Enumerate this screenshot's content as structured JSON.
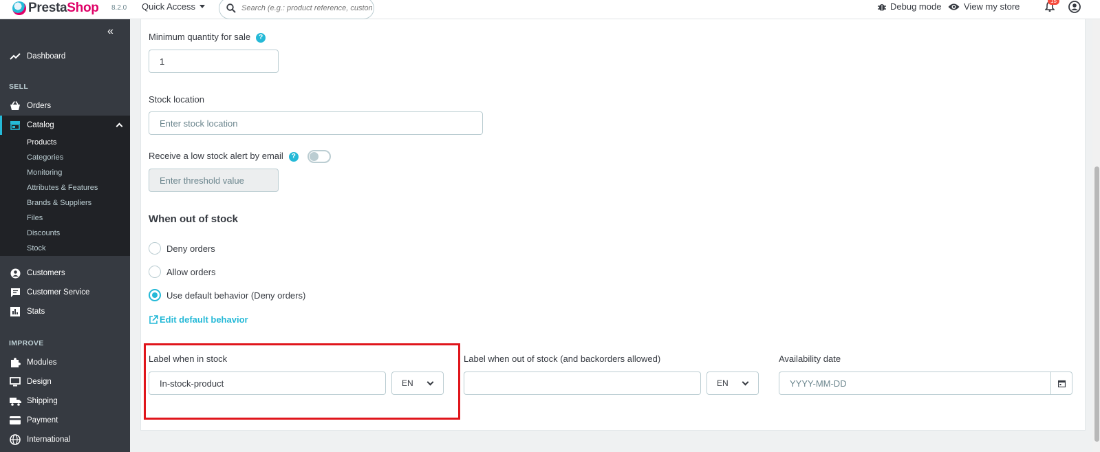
{
  "header": {
    "logo_text_a": "Presta",
    "logo_text_b": "Shop",
    "version": "8.2.0",
    "quick_access": "Quick Access",
    "search_placeholder": "Search (e.g.: product reference, custon",
    "debug_mode": "Debug mode",
    "view_store": "View my store",
    "notifications_count": "15"
  },
  "sidebar": {
    "dashboard": "Dashboard",
    "section_sell": "SELL",
    "orders": "Orders",
    "catalog": "Catalog",
    "catalog_sub": [
      "Products",
      "Categories",
      "Monitoring",
      "Attributes & Features",
      "Brands & Suppliers",
      "Files",
      "Discounts",
      "Stock"
    ],
    "customers": "Customers",
    "customer_service": "Customer Service",
    "stats": "Stats",
    "section_improve": "IMPROVE",
    "modules": "Modules",
    "design": "Design",
    "shipping": "Shipping",
    "payment": "Payment",
    "international": "International"
  },
  "form": {
    "min_qty_label": "Minimum quantity for sale",
    "min_qty_value": "1",
    "stock_location_label": "Stock location",
    "stock_location_placeholder": "Enter stock location",
    "low_stock_label": "Receive a low stock alert by email",
    "threshold_placeholder": "Enter threshold value",
    "out_of_stock_heading": "When out of stock",
    "radio_deny": "Deny orders",
    "radio_allow": "Allow orders",
    "radio_default": "Use default behavior (Deny orders)",
    "edit_default": "Edit default behavior",
    "label_in_stock": "Label when in stock",
    "label_in_stock_value": "In-stock-product",
    "lang_1": "EN",
    "label_out_of_stock": "Label when out of stock (and backorders allowed)",
    "label_out_of_stock_value": "",
    "lang_2": "EN",
    "availability_label": "Availability date",
    "availability_placeholder": "YYYY-MM-DD"
  }
}
